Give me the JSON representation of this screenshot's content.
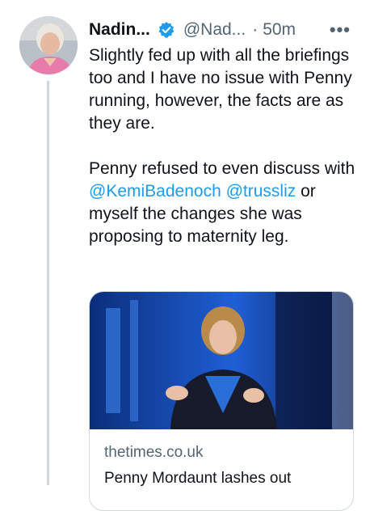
{
  "tweet": {
    "display_name": "Nadin...",
    "handle": "@Nad...",
    "separator": "·",
    "time": "50m",
    "more_label": "•••",
    "text_p1": "Slightly fed up with all the briefings too and I have no issue with Penny running, however, the facts are as they are.",
    "text_p2_before": "Penny refused to even discuss with ",
    "mention_1": "@KemiBadenoch",
    "mention_2": "@trussliz",
    "text_p2_after": " or myself the changes she was proposing to maternity leg."
  },
  "link_card": {
    "domain": "thetimes.co.uk",
    "title": "Penny Mordaunt lashes out"
  },
  "icons": {
    "verified": "verified-badge-icon",
    "more": "more-options-icon"
  },
  "colors": {
    "accent": "#1d9bf0",
    "secondary_text": "#536471",
    "border": "#cfd9de"
  }
}
